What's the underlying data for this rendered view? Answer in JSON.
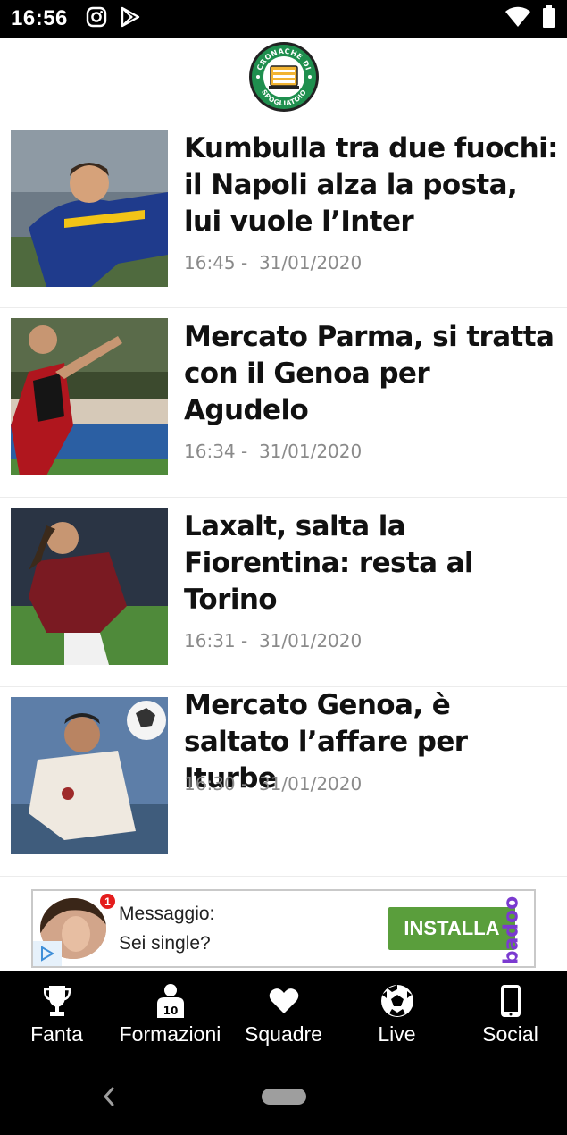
{
  "status_bar": {
    "time": "16:56",
    "icons_left": [
      "instagram-icon",
      "play-store-icon"
    ],
    "icons_right": [
      "wifi-icon",
      "battery-icon"
    ]
  },
  "header": {
    "logo_top_text": "CRONACHE DI",
    "logo_bottom_text": "SPOGLIATOIO",
    "brand_color": "#1f8f4e"
  },
  "news": [
    {
      "title": "Kumbulla tra due fuochi: il Napoli alza la posta, lui vuole l’Inter",
      "time": "16:45",
      "date": "31/01/2020"
    },
    {
      "title": "Mercato Parma, si tratta con il Genoa per Agudelo",
      "time": "16:34",
      "date": "31/01/2020"
    },
    {
      "title": "Laxalt, salta la Fiorentina: resta al Torino",
      "time": "16:31",
      "date": "31/01/2020"
    },
    {
      "title": "Mercato Genoa, è saltato l’affare per Iturbe",
      "time": "16:30",
      "date": "31/01/2020"
    }
  ],
  "ad": {
    "badge_count": "1",
    "title": "Messaggio:",
    "subtitle": "Sei single?",
    "button_label": "INSTALLA",
    "brand": "badoo",
    "button_color": "#5a9e3c",
    "brand_color": "#7b3ad0"
  },
  "bottom_nav": [
    {
      "label": "Fanta",
      "icon": "trophy-icon"
    },
    {
      "label": "Formazioni",
      "icon": "player-icon"
    },
    {
      "label": "Squadre",
      "icon": "heart-icon"
    },
    {
      "label": "Live",
      "icon": "soccer-ball-icon"
    },
    {
      "label": "Social",
      "icon": "smartphone-icon"
    }
  ]
}
